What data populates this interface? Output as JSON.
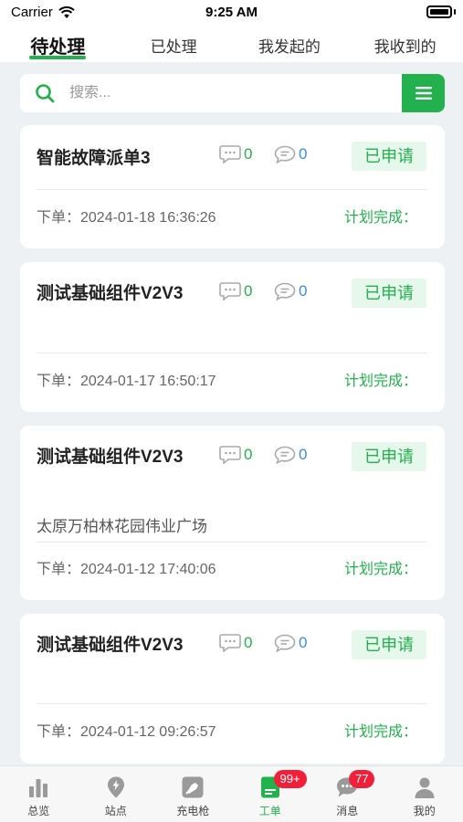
{
  "status_bar": {
    "carrier": "Carrier",
    "time": "9:25 AM"
  },
  "tabs": [
    {
      "label": "待处理",
      "active": true
    },
    {
      "label": "已处理",
      "active": false
    },
    {
      "label": "我发起的",
      "active": false
    },
    {
      "label": "我收到的",
      "active": false
    }
  ],
  "search": {
    "placeholder": "搜索..."
  },
  "cards": [
    {
      "title": "智能故障派单3",
      "comments": "0",
      "messages": "0",
      "status": "已申请",
      "location": "",
      "order_time": "下单：2024-01-18 16:36:26",
      "plan_label": "计划完成："
    },
    {
      "title": "测试基础组件V2V3",
      "comments": "0",
      "messages": "0",
      "status": "已申请",
      "location": "",
      "order_time": "下单：2024-01-17 16:50:17",
      "plan_label": "计划完成："
    },
    {
      "title": "测试基础组件V2V3",
      "comments": "0",
      "messages": "0",
      "status": "已申请",
      "location": "太原万柏林花园伟业广场",
      "order_time": "下单：2024-01-12 17:40:06",
      "plan_label": "计划完成："
    },
    {
      "title": "测试基础组件V2V3",
      "comments": "0",
      "messages": "0",
      "status": "已申请",
      "location": "",
      "order_time": "下单：2024-01-12 09:26:57",
      "plan_label": "计划完成："
    }
  ],
  "bottom_nav": [
    {
      "label": "总览",
      "icon": "bar-chart-icon"
    },
    {
      "label": "站点",
      "icon": "location-pin-icon"
    },
    {
      "label": "充电枪",
      "icon": "charging-gun-icon"
    },
    {
      "label": "工单",
      "icon": "work-order-icon",
      "badge": "99+",
      "active": true
    },
    {
      "label": "消息",
      "icon": "message-icon",
      "badge": "77"
    },
    {
      "label": "我的",
      "icon": "user-icon"
    }
  ],
  "colors": {
    "accent": "#22b14c",
    "badge_red": "#f0203a",
    "link_blue": "#3b8fd9"
  }
}
